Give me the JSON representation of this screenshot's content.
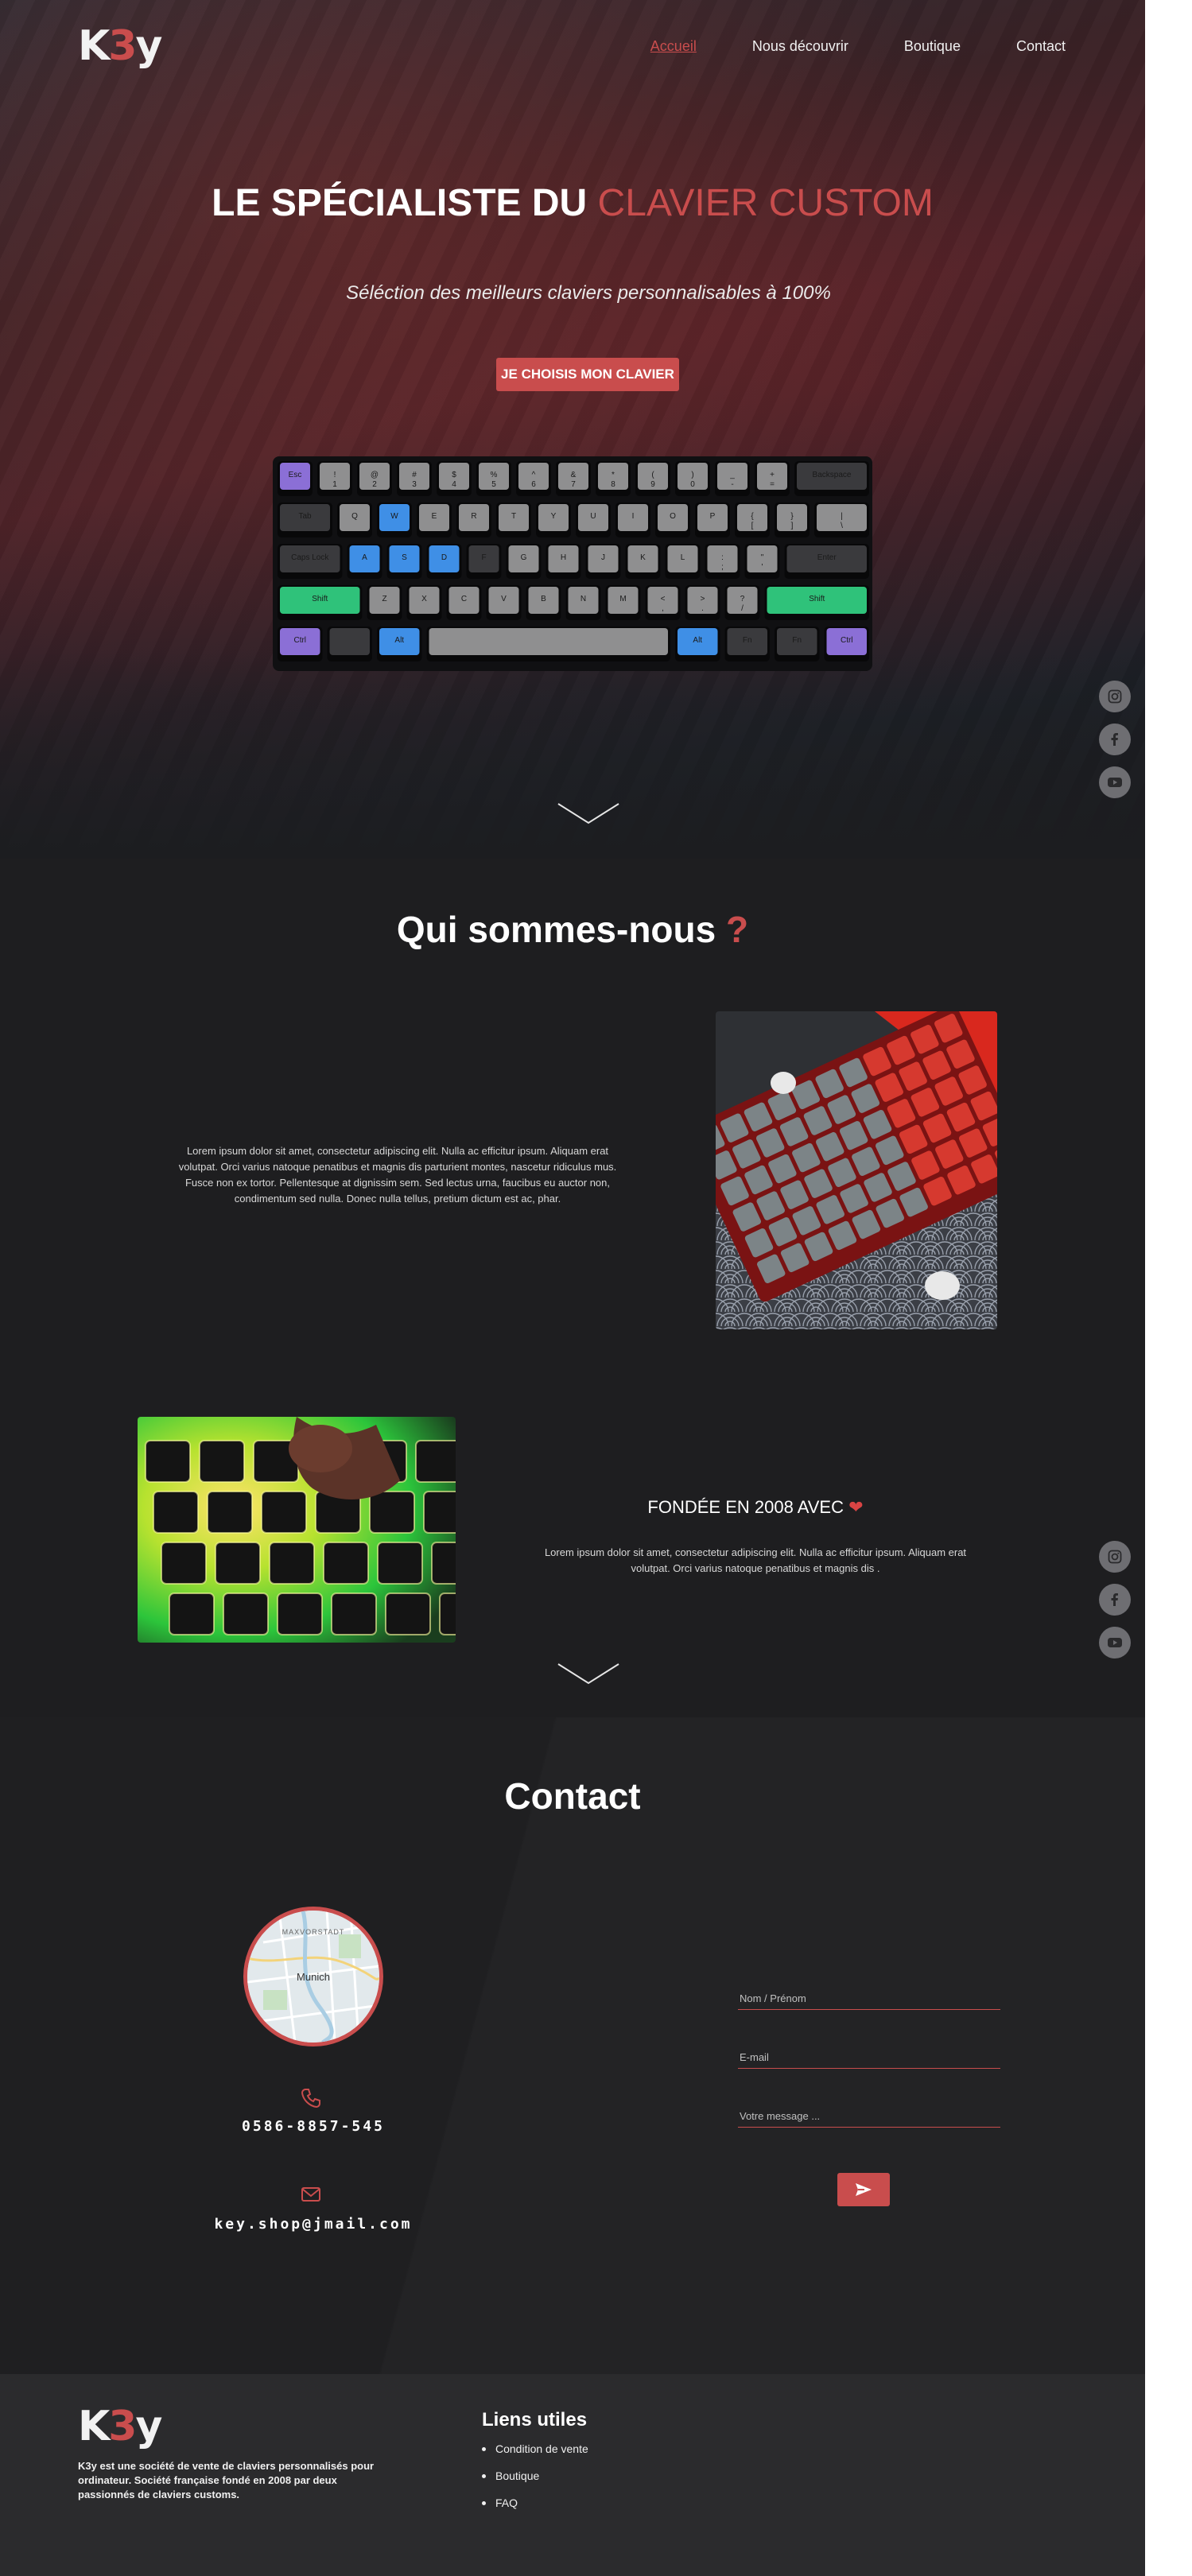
{
  "brand": {
    "logo_k": "K",
    "logo_3": "3",
    "logo_y": "y"
  },
  "nav": {
    "items": [
      {
        "label": "Accueil",
        "active": true
      },
      {
        "label": "Nous découvrir",
        "active": false
      },
      {
        "label": "Boutique",
        "active": false
      },
      {
        "label": "Contact",
        "active": false
      }
    ]
  },
  "hero": {
    "title_main": "LE SPÉCIALISTE DU ",
    "title_accent": "CLAVIER CUSTOM",
    "subtitle": "Séléction des meilleurs claviers personnalisables à 100%",
    "cta_label": "JE CHOISIS MON CLAVIER",
    "keyboard_keys": {
      "row1": [
        "Esc",
        "!\n1",
        "@\n2",
        "#\n3",
        "$\n4",
        "%\n5",
        "^\n6",
        "&\n7",
        "*\n8",
        "(\n9",
        ")\n0",
        "_\n-",
        "+\n=",
        "Backspace"
      ],
      "row2": [
        "Tab",
        "Q",
        "W",
        "E",
        "R",
        "T",
        "Y",
        "U",
        "I",
        "O",
        "P",
        "{\n[",
        "}\n]",
        "|\n\\"
      ],
      "row3": [
        "Caps Lock",
        "A",
        "S",
        "D",
        "F",
        "G",
        "H",
        "J",
        "K",
        "L",
        ":\n;",
        "\"\n'",
        "Enter"
      ],
      "row4": [
        "Shift",
        "Z",
        "X",
        "C",
        "V",
        "B",
        "N",
        "M",
        "<\n,",
        ">\n.",
        "?\n/",
        "Shift"
      ],
      "row5": [
        "Ctrl",
        "",
        "Alt",
        "",
        "Alt",
        "Fn",
        "Fn",
        "Ctrl"
      ]
    }
  },
  "social": [
    "instagram-icon",
    "facebook-icon",
    "youtube-icon"
  ],
  "about": {
    "title": "Qui sommes-nous ",
    "title_mark": "?",
    "text1": "Lorem ipsum dolor sit amet, consectetur adipiscing elit. Nulla ac efficitur ipsum. Aliquam erat volutpat. Orci varius natoque penatibus et magnis dis parturient montes, nascetur ridiculus mus. Fusce non ex tortor. Pellentesque at dignissim sem. Sed lectus urna, faucibus eu auctor non, condimentum sed nulla. Donec nulla tellus, pretium dictum est ac, phar.",
    "founded_title": "FONDÉE EN 2008 AVEC ",
    "founded_heart": "❤",
    "text2": "Lorem ipsum dolor sit amet, consectetur adipiscing elit. Nulla ac efficitur ipsum. Aliquam erat volutpat. Orci varius natoque penatibus et magnis dis ."
  },
  "contact": {
    "title": "Contact",
    "map_label_top": "MAXVORSTADT",
    "map_label_city": "Munich",
    "phone": "0586-8857-545",
    "email": "key.shop@jmail.com",
    "name_placeholder": "Nom / Prénom",
    "email_placeholder": "E-mail",
    "message_placeholder": "Votre message ..."
  },
  "footer": {
    "description": "K3y est une société de vente de claviers personnalisés pour ordinateur. Société française fondé en 2008 par deux passionnés de claviers customs.",
    "links_title": "Liens utiles",
    "links": [
      "Condition de vente",
      "Boutique",
      "FAQ"
    ]
  },
  "colors": {
    "accent": "#c94d4d",
    "bg": "#1e1e20",
    "footer": "#2b2b2d"
  }
}
